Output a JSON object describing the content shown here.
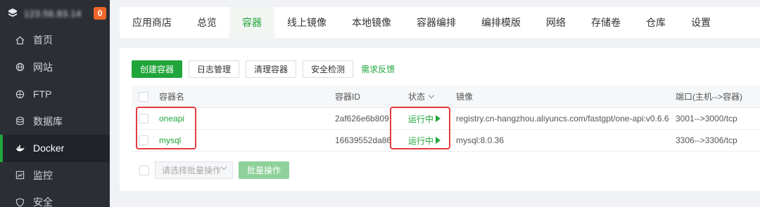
{
  "sidebar": {
    "host": "123.56.83.14",
    "badge": "0",
    "items": [
      {
        "label": "首页",
        "icon": "home-icon"
      },
      {
        "label": "网站",
        "icon": "globe-icon"
      },
      {
        "label": "FTP",
        "icon": "ftp-globe-icon"
      },
      {
        "label": "数据库",
        "icon": "database-icon"
      },
      {
        "label": "Docker",
        "icon": "docker-icon"
      },
      {
        "label": "监控",
        "icon": "monitor-icon"
      },
      {
        "label": "安全",
        "icon": "shield-icon"
      }
    ]
  },
  "tabs": [
    "应用商店",
    "总览",
    "容器",
    "线上镜像",
    "本地镜像",
    "容器编排",
    "编排模版",
    "网络",
    "存储卷",
    "仓库",
    "设置"
  ],
  "toolbar": {
    "create": "创建容器",
    "logs": "日志管理",
    "clean": "清理容器",
    "security": "安全检测",
    "feedback": "需求反馈"
  },
  "table": {
    "headers": {
      "name": "容器名",
      "id": "容器ID",
      "status": "状态",
      "image": "镜像",
      "port": "端口(主机-->容器)"
    },
    "rows": [
      {
        "name": "oneapi",
        "id": "2af626e6b809",
        "status": "运行中",
        "image": "registry.cn-hangzhou.aliyuncs.com/fastgpt/one-api:v0.6.6",
        "port": "3001-->3000/tcp"
      },
      {
        "name": "mysql",
        "id": "16639552da86",
        "status": "运行中",
        "image": "mysql:8.0.36",
        "port": "3306-->3306/tcp"
      }
    ]
  },
  "footer": {
    "select_placeholder": "请选择批量操作",
    "batch": "批量操作"
  },
  "colors": {
    "accent": "#20a53a",
    "highlight": "#e63b3b",
    "sidebar": "#2b2e35"
  }
}
